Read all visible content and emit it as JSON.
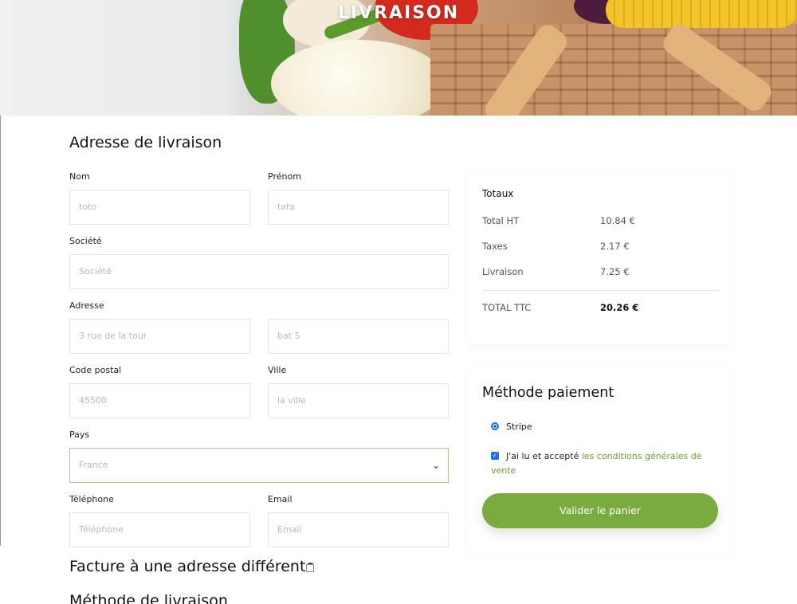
{
  "hero": {
    "title": "LIVRAISON"
  },
  "shipping": {
    "title": "Adresse de livraison",
    "nom_label": "Nom",
    "nom_value": "toto",
    "prenom_label": "Prénom",
    "prenom_value": "tata",
    "societe_label": "Société",
    "societe_placeholder": "Société",
    "adresse_label": "Adresse",
    "adresse1_value": "3 rue de la tour",
    "adresse2_value": "bat 5",
    "cp_label": "Code postal",
    "cp_value": "45500",
    "ville_label": "Ville",
    "ville_placeholder": "la ville",
    "pays_label": "Pays",
    "pays_value": "France",
    "tel_label": "Téléphone",
    "tel_placeholder": "Téléphone",
    "email_label": "Email",
    "email_placeholder": "Email"
  },
  "billing": {
    "label": "Facture à une adresse différente"
  },
  "delivery_method": {
    "title": "Méthode de livraison"
  },
  "totals": {
    "title": "Totaux",
    "rows": [
      {
        "label": "Total HT",
        "value": "10.84 €"
      },
      {
        "label": "Taxes",
        "value": "2.17 €"
      },
      {
        "label": "Livraison",
        "value": "7.25 €"
      }
    ],
    "total_label": "TOTAL TTC",
    "total_value": "20.26 €"
  },
  "payment": {
    "title": "Méthode paiement",
    "option": "Stripe",
    "terms_prefix": "J'ai lu et accepté",
    "terms_link_1": "les conditions générales de",
    "terms_link_2": "vente",
    "submit": "Valider le panier"
  },
  "colors": {
    "accent": "#7aab3f",
    "link": "#6b9e35",
    "control": "#1a73e8"
  }
}
